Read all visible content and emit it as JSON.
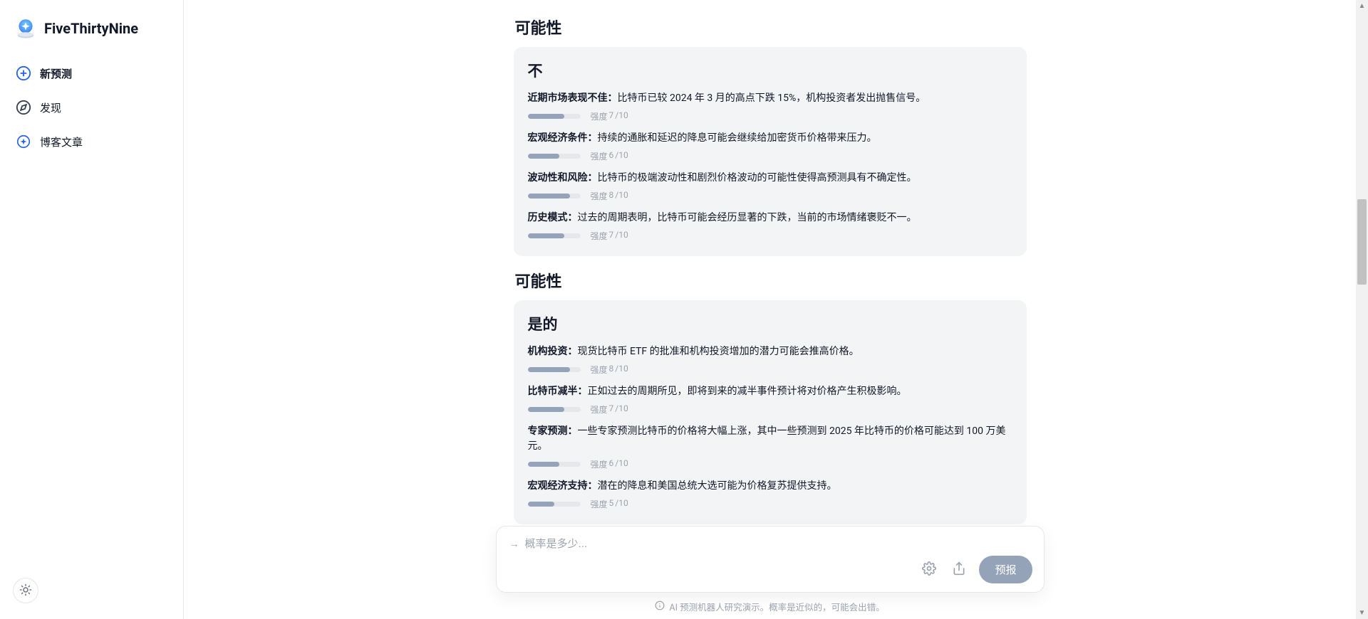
{
  "brand": {
    "name": "FiveThirtyNine"
  },
  "sidebar": {
    "items": [
      {
        "label": "新预测"
      },
      {
        "label": "发现"
      },
      {
        "label": "博客文章"
      }
    ]
  },
  "sections": [
    {
      "title": "可能性",
      "card_title": "不",
      "args": [
        {
          "label": "近期市场表现不佳：",
          "desc": "比特币已较 2024 年 3 月的高点下跌 15%，机构投资者发出抛售信号。",
          "strength_prefix": "强度",
          "strength_val": "7",
          "strength_suffix": "/10",
          "bar_pct": 70
        },
        {
          "label": "宏观经济条件：",
          "desc": "持续的通胀和延迟的降息可能会继续给加密货币价格带来压力。",
          "strength_prefix": "强度",
          "strength_val": "6",
          "strength_suffix": "/10",
          "bar_pct": 60
        },
        {
          "label": "波动性和风险：",
          "desc": "比特币的极端波动性和剧烈价格波动的可能性使得高预测具有不确定性。",
          "strength_prefix": "强度",
          "strength_val": "8",
          "strength_suffix": "/10",
          "bar_pct": 80
        },
        {
          "label": "历史模式：",
          "desc": "过去的周期表明，比特币可能会经历显著的下跌，当前的市场情绪褒贬不一。",
          "strength_prefix": "强度",
          "strength_val": "7",
          "strength_suffix": "/10",
          "bar_pct": 70
        }
      ]
    },
    {
      "title": "可能性",
      "card_title": "是的",
      "args": [
        {
          "label": "机构投资：",
          "desc": "现货比特币 ETF 的批准和机构投资增加的潜力可能会推高价格。",
          "strength_prefix": "强度",
          "strength_val": "8",
          "strength_suffix": "/10",
          "bar_pct": 80
        },
        {
          "label": "比特币减半：",
          "desc": "正如过去的周期所见，即将到来的减半事件预计将对价格产生积极影响。",
          "strength_prefix": "强度",
          "strength_val": "7",
          "strength_suffix": "/10",
          "bar_pct": 70
        },
        {
          "label": "专家预测：",
          "desc": "一些专家预测比特币的价格将大幅上涨，其中一些预测到 2025 年比特币的价格可能达到 100 万美元。",
          "strength_prefix": "强度",
          "strength_val": "6",
          "strength_suffix": "/10",
          "bar_pct": 60
        },
        {
          "label": "宏观经济支持：",
          "desc": "潜在的降息和美国总统大选可能为价格复苏提供支持。",
          "strength_prefix": "强度",
          "strength_val": "5",
          "strength_suffix": "/10",
          "bar_pct": 50
        }
      ]
    }
  ],
  "composer": {
    "placeholder": "概率是多少...",
    "submit_label": "预报"
  },
  "disclaimer": "AI 预测机器人研究演示。概率是近似的，可能会出错。"
}
